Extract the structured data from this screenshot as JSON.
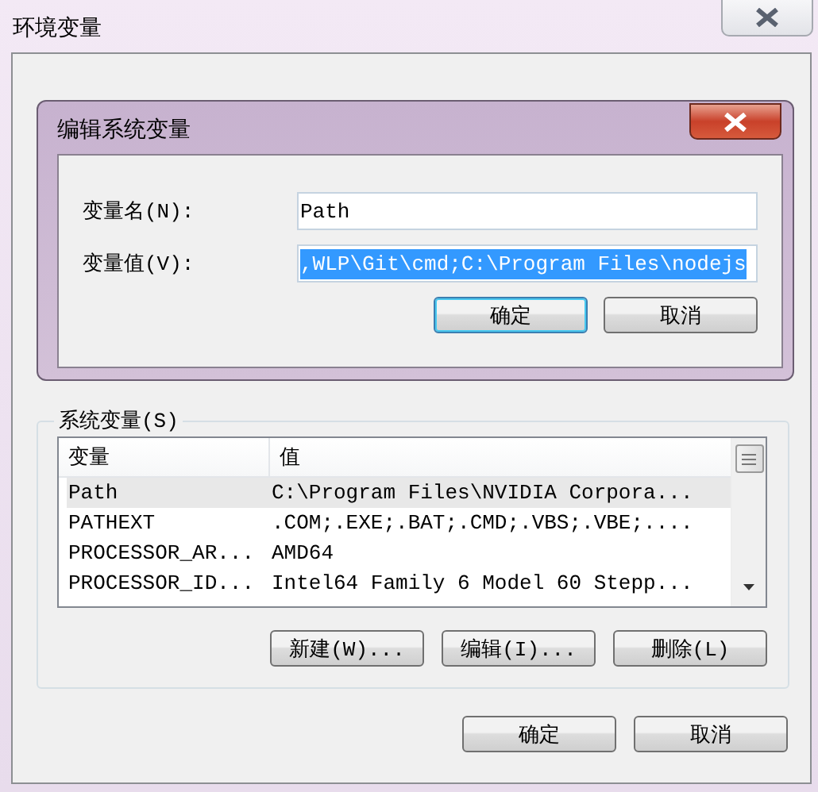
{
  "window": {
    "title": "环境变量"
  },
  "edit_dialog": {
    "title": "编辑系统变量",
    "fields": [
      {
        "label": "变量名(N):",
        "value": "Path",
        "selected": false
      },
      {
        "label": "变量值(V):",
        "value": ",WLP\\Git\\cmd;C:\\Program Files\\nodejs",
        "selected": true
      }
    ],
    "buttons": [
      {
        "label": "确定",
        "default": true
      },
      {
        "label": "取消",
        "default": false
      }
    ]
  },
  "system_variables": {
    "title": "系统变量(S)",
    "columns": [
      "变量",
      "值"
    ],
    "rows": [
      {
        "cells": [
          "Path",
          "C:\\Program Files\\NVIDIA Corpora..."
        ],
        "selected": true
      },
      {
        "cells": [
          "PATHEXT",
          ".COM;.EXE;.BAT;.CMD;.VBS;.VBE;...."
        ],
        "selected": false
      },
      {
        "cells": [
          "PROCESSOR_AR...",
          "AMD64"
        ],
        "selected": false
      },
      {
        "cells": [
          "PROCESSOR_ID...",
          "Intel64 Family 6 Model 60 Stepp..."
        ],
        "selected": false
      }
    ],
    "buttons": [
      "新建(W)...",
      "编辑(I)...",
      "删除(L)"
    ]
  },
  "buttons": [
    "确定",
    "取消"
  ]
}
